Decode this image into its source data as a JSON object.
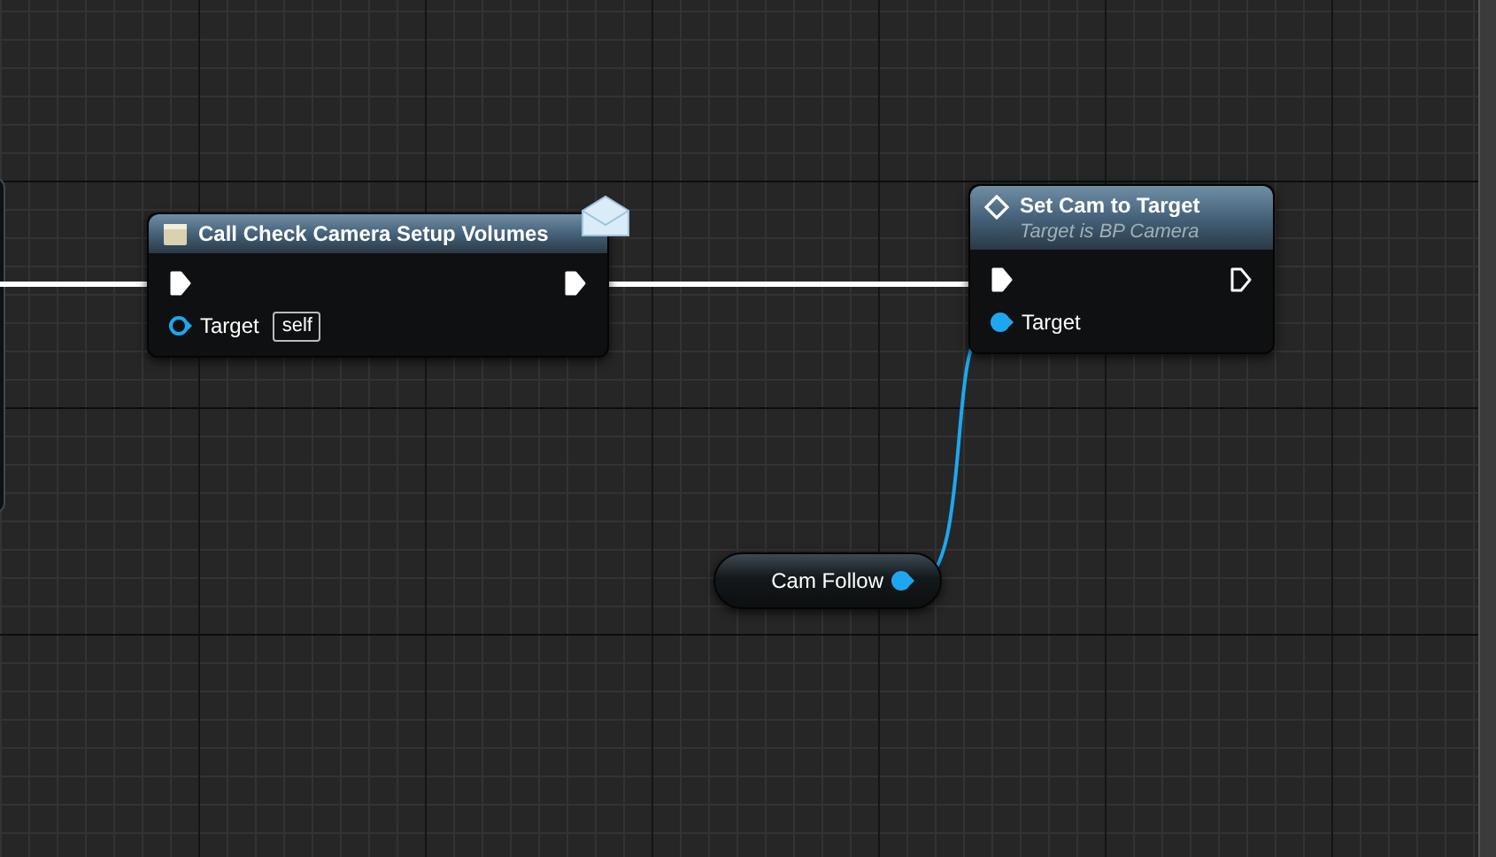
{
  "nodes": [
    {
      "kind": "message",
      "title": "Call Check Camera Setup Volumes",
      "pins": [
        {
          "kind": "exec_in",
          "connected": true
        },
        {
          "kind": "exec_out",
          "connected": true
        },
        {
          "kind": "data",
          "label": "Target",
          "default": "self",
          "connected": false
        }
      ]
    },
    {
      "kind": "function",
      "title": "Set Cam to Target",
      "subtitle": "Target is BP Camera",
      "pins": [
        {
          "kind": "exec_in",
          "connected": true
        },
        {
          "kind": "exec_out",
          "connected": false
        },
        {
          "kind": "data",
          "label": "Target",
          "connected": true
        }
      ]
    },
    {
      "kind": "variable",
      "title": "Cam Follow",
      "connected": true
    }
  ]
}
